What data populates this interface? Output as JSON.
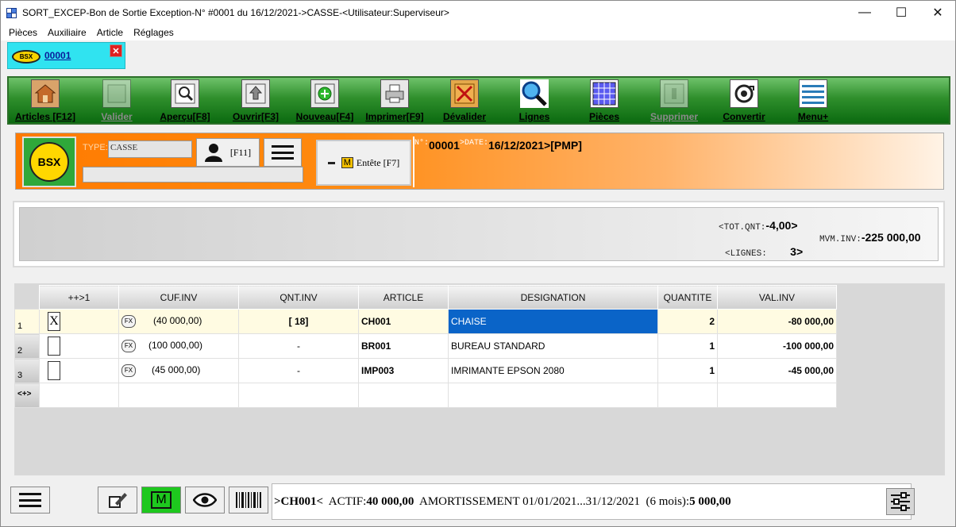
{
  "window": {
    "title": "SORT_EXCEP-Bon de Sortie Exception-N° #0001 du 16/12/2021->CASSE-<Utilisateur:Superviseur>",
    "minimize": "—",
    "maximize": "☐",
    "close": "✕"
  },
  "menu": [
    "Pièces",
    "Auxiliaire",
    "Article",
    "Réglages"
  ],
  "doc_tab": {
    "badge": "BSX",
    "number": "00001",
    "close": "✕"
  },
  "toolbar": [
    {
      "label": "Articles [F12]",
      "icon": "articles-icon",
      "enabled": true
    },
    {
      "label": "Valider",
      "icon": "validate-icon",
      "enabled": false
    },
    {
      "label": "Aperçu[F8]",
      "icon": "preview-icon",
      "enabled": true
    },
    {
      "label": "Ouvrir[F3]",
      "icon": "open-icon",
      "enabled": true
    },
    {
      "label": "Nouveau[F4]",
      "icon": "new-icon",
      "enabled": true
    },
    {
      "label": "Imprimer[F9]",
      "icon": "print-icon",
      "enabled": true
    },
    {
      "label": "Dévalider",
      "icon": "unvalidate-icon",
      "enabled": true
    },
    {
      "label": "Lignes",
      "icon": "search-lines-icon",
      "enabled": true
    },
    {
      "label": "Pièces",
      "icon": "pieces-icon",
      "enabled": true
    },
    {
      "label": "Supprimer",
      "icon": "delete-icon",
      "enabled": false
    },
    {
      "label": "Convertir",
      "icon": "convert-icon",
      "enabled": true
    },
    {
      "label": "Menu+",
      "icon": "menu-plus-icon",
      "enabled": true
    }
  ],
  "header": {
    "badge": "BSX",
    "type_label": "TYPE:",
    "type_value": "CASSE",
    "user_shortcut": "[F11]",
    "entete_badge": "M",
    "entete_label": "Entête [F7]",
    "num_label": "N°:",
    "num_value": "00001",
    "date_label": ">DATE:",
    "date_value": "16/12/2021",
    "method": ">[PMP]"
  },
  "totals": {
    "tot_qnt_label": "<TOT.QNT:",
    "tot_qnt_value": "-4,00>",
    "lignes_label": "<LIGNES:",
    "lignes_value": "3>",
    "mvm_inv_label": "MVM.INV:",
    "mvm_inv_value": "-225 000,00"
  },
  "grid": {
    "columns": [
      "++>1",
      "CUF.INV",
      "QNT.INV",
      "ARTICLE",
      "DESIGNATION",
      "QUANTITE",
      "VAL.INV"
    ],
    "rows": [
      {
        "n": "1",
        "checked": "X",
        "cuf": "(40 000,00)",
        "qnt": "[ 18]",
        "article": "CH001",
        "designation": "CHAISE",
        "quantite": "2",
        "val": "-80 000,00"
      },
      {
        "n": "2",
        "checked": "",
        "cuf": "(100 000,00)",
        "qnt": "-",
        "article": "BR001",
        "designation": "BUREAU STANDARD",
        "quantite": "1",
        "val": "-100 000,00"
      },
      {
        "n": "3",
        "checked": "",
        "cuf": "(45 000,00)",
        "qnt": "-",
        "article": "IMP003",
        "designation": "IMRIMANTE EPSON 2080",
        "quantite": "1",
        "val": "-45 000,00"
      }
    ],
    "fx_label": "FX",
    "new_row_marker": "<+>"
  },
  "status": {
    "m_badge": "M",
    "article": ">CH001<",
    "actif_label": "ACTIF:",
    "actif_value": "40 000,00",
    "amort_label": "AMORTISSEMENT 01/01/2021...31/12/2021",
    "period_label": "(6 mois):",
    "period_value": "5 000,00"
  },
  "colors": {
    "toolbar_green": "#2f8f2c",
    "header_orange": "#ff7a00",
    "tab_cyan": "#30e3f0",
    "selection_blue": "#0a64c8"
  }
}
